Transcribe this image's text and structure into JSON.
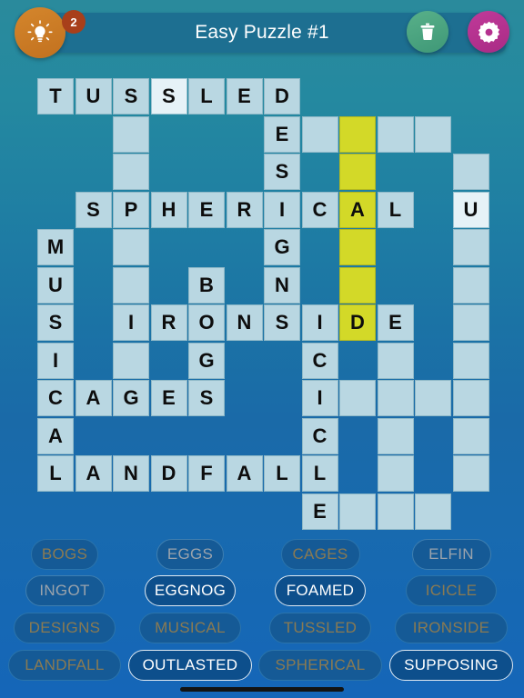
{
  "header": {
    "title": "Easy Puzzle #1",
    "hint_badge_count": "2",
    "hint_icon": "lightbulb-icon",
    "trash_icon": "trash-icon",
    "settings_icon": "gear-icon"
  },
  "colors": {
    "accent_orange": "#c2711f",
    "accent_green": "#3f9877",
    "accent_magenta": "#a92b85",
    "highlight_yellow": "#d3d928",
    "cell_open": "#b9d7e2",
    "cell_focus": "#e6f2f7",
    "header_bar": "#1d6f91"
  },
  "grid": {
    "columns": 12,
    "rows": 12,
    "cell_size": 41.5,
    "cells": [
      {
        "r": 0,
        "c": 0,
        "l": "T",
        "s": "open"
      },
      {
        "r": 0,
        "c": 1,
        "l": "U",
        "s": "open"
      },
      {
        "r": 0,
        "c": 2,
        "l": "S",
        "s": "open"
      },
      {
        "r": 0,
        "c": 3,
        "l": "S",
        "s": "focus"
      },
      {
        "r": 0,
        "c": 4,
        "l": "L",
        "s": "open"
      },
      {
        "r": 0,
        "c": 5,
        "l": "E",
        "s": "open"
      },
      {
        "r": 0,
        "c": 6,
        "l": "D",
        "s": "open"
      },
      {
        "r": 1,
        "c": 2,
        "l": "",
        "s": "open"
      },
      {
        "r": 1,
        "c": 6,
        "l": "E",
        "s": "open"
      },
      {
        "r": 1,
        "c": 7,
        "l": "",
        "s": "open"
      },
      {
        "r": 1,
        "c": 8,
        "l": "",
        "s": "hl"
      },
      {
        "r": 1,
        "c": 9,
        "l": "",
        "s": "open"
      },
      {
        "r": 1,
        "c": 10,
        "l": "",
        "s": "open"
      },
      {
        "r": 2,
        "c": 2,
        "l": "",
        "s": "open"
      },
      {
        "r": 2,
        "c": 6,
        "l": "S",
        "s": "open"
      },
      {
        "r": 2,
        "c": 8,
        "l": "",
        "s": "hl"
      },
      {
        "r": 2,
        "c": 11,
        "l": "",
        "s": "open"
      },
      {
        "r": 3,
        "c": 1,
        "l": "S",
        "s": "open"
      },
      {
        "r": 3,
        "c": 2,
        "l": "P",
        "s": "open"
      },
      {
        "r": 3,
        "c": 3,
        "l": "H",
        "s": "open"
      },
      {
        "r": 3,
        "c": 4,
        "l": "E",
        "s": "open"
      },
      {
        "r": 3,
        "c": 5,
        "l": "R",
        "s": "open"
      },
      {
        "r": 3,
        "c": 6,
        "l": "I",
        "s": "open"
      },
      {
        "r": 3,
        "c": 7,
        "l": "C",
        "s": "open"
      },
      {
        "r": 3,
        "c": 8,
        "l": "A",
        "s": "hl"
      },
      {
        "r": 3,
        "c": 9,
        "l": "L",
        "s": "open"
      },
      {
        "r": 3,
        "c": 11,
        "l": "U",
        "s": "focus"
      },
      {
        "r": 4,
        "c": 0,
        "l": "M",
        "s": "open"
      },
      {
        "r": 4,
        "c": 2,
        "l": "",
        "s": "open"
      },
      {
        "r": 4,
        "c": 6,
        "l": "G",
        "s": "open"
      },
      {
        "r": 4,
        "c": 8,
        "l": "",
        "s": "hl"
      },
      {
        "r": 4,
        "c": 11,
        "l": "",
        "s": "open"
      },
      {
        "r": 5,
        "c": 0,
        "l": "U",
        "s": "open"
      },
      {
        "r": 5,
        "c": 2,
        "l": "",
        "s": "open"
      },
      {
        "r": 5,
        "c": 4,
        "l": "B",
        "s": "open"
      },
      {
        "r": 5,
        "c": 6,
        "l": "N",
        "s": "open"
      },
      {
        "r": 5,
        "c": 8,
        "l": "",
        "s": "hl"
      },
      {
        "r": 5,
        "c": 11,
        "l": "",
        "s": "open"
      },
      {
        "r": 6,
        "c": 0,
        "l": "S",
        "s": "open"
      },
      {
        "r": 6,
        "c": 2,
        "l": "I",
        "s": "open"
      },
      {
        "r": 6,
        "c": 3,
        "l": "R",
        "s": "open"
      },
      {
        "r": 6,
        "c": 4,
        "l": "O",
        "s": "open"
      },
      {
        "r": 6,
        "c": 5,
        "l": "N",
        "s": "open"
      },
      {
        "r": 6,
        "c": 6,
        "l": "S",
        "s": "open"
      },
      {
        "r": 6,
        "c": 7,
        "l": "I",
        "s": "open"
      },
      {
        "r": 6,
        "c": 8,
        "l": "D",
        "s": "hl"
      },
      {
        "r": 6,
        "c": 9,
        "l": "E",
        "s": "open"
      },
      {
        "r": 6,
        "c": 11,
        "l": "",
        "s": "open"
      },
      {
        "r": 7,
        "c": 0,
        "l": "I",
        "s": "open"
      },
      {
        "r": 7,
        "c": 2,
        "l": "",
        "s": "open"
      },
      {
        "r": 7,
        "c": 4,
        "l": "G",
        "s": "open"
      },
      {
        "r": 7,
        "c": 7,
        "l": "C",
        "s": "open"
      },
      {
        "r": 7,
        "c": 9,
        "l": "",
        "s": "open"
      },
      {
        "r": 7,
        "c": 11,
        "l": "",
        "s": "open"
      },
      {
        "r": 8,
        "c": 0,
        "l": "C",
        "s": "open"
      },
      {
        "r": 8,
        "c": 1,
        "l": "A",
        "s": "open"
      },
      {
        "r": 8,
        "c": 2,
        "l": "G",
        "s": "open"
      },
      {
        "r": 8,
        "c": 3,
        "l": "E",
        "s": "open"
      },
      {
        "r": 8,
        "c": 4,
        "l": "S",
        "s": "open"
      },
      {
        "r": 8,
        "c": 7,
        "l": "I",
        "s": "open"
      },
      {
        "r": 8,
        "c": 8,
        "l": "",
        "s": "open"
      },
      {
        "r": 8,
        "c": 9,
        "l": "",
        "s": "open"
      },
      {
        "r": 8,
        "c": 10,
        "l": "",
        "s": "open"
      },
      {
        "r": 8,
        "c": 11,
        "l": "",
        "s": "open"
      },
      {
        "r": 9,
        "c": 0,
        "l": "A",
        "s": "open"
      },
      {
        "r": 9,
        "c": 7,
        "l": "C",
        "s": "open"
      },
      {
        "r": 9,
        "c": 9,
        "l": "",
        "s": "open"
      },
      {
        "r": 9,
        "c": 11,
        "l": "",
        "s": "open"
      },
      {
        "r": 10,
        "c": 0,
        "l": "L",
        "s": "open"
      },
      {
        "r": 10,
        "c": 1,
        "l": "A",
        "s": "open"
      },
      {
        "r": 10,
        "c": 2,
        "l": "N",
        "s": "open"
      },
      {
        "r": 10,
        "c": 3,
        "l": "D",
        "s": "open"
      },
      {
        "r": 10,
        "c": 4,
        "l": "F",
        "s": "open"
      },
      {
        "r": 10,
        "c": 5,
        "l": "A",
        "s": "open"
      },
      {
        "r": 10,
        "c": 6,
        "l": "L",
        "s": "open"
      },
      {
        "r": 10,
        "c": 7,
        "l": "L",
        "s": "open"
      },
      {
        "r": 10,
        "c": 9,
        "l": "",
        "s": "open"
      },
      {
        "r": 10,
        "c": 11,
        "l": "",
        "s": "open"
      },
      {
        "r": 11,
        "c": 7,
        "l": "E",
        "s": "open"
      },
      {
        "r": 11,
        "c": 8,
        "l": "",
        "s": "open"
      },
      {
        "r": 11,
        "c": 9,
        "l": "",
        "s": "open"
      },
      {
        "r": 11,
        "c": 10,
        "l": "",
        "s": "open"
      }
    ]
  },
  "wordbank": {
    "rows": [
      [
        {
          "label": "BOGS",
          "state": "used-tan"
        },
        {
          "label": "EGGS",
          "state": "used-gray"
        },
        {
          "label": "CAGES",
          "state": "used-tan"
        },
        {
          "label": "ELFIN",
          "state": "used-gray"
        }
      ],
      [
        {
          "label": "INGOT",
          "state": "used-gray"
        },
        {
          "label": "EGGNOG",
          "state": "avail"
        },
        {
          "label": "FOAMED",
          "state": "avail"
        },
        {
          "label": "ICICLE",
          "state": "used-tan"
        }
      ],
      [
        {
          "label": "DESIGNS",
          "state": "used-tan"
        },
        {
          "label": "MUSICAL",
          "state": "used-tan"
        },
        {
          "label": "TUSSLED",
          "state": "used-tan"
        },
        {
          "label": "IRONSIDE",
          "state": "used-tan"
        }
      ],
      [
        {
          "label": "LANDFALL",
          "state": "used-tan"
        },
        {
          "label": "OUTLASTED",
          "state": "avail"
        },
        {
          "label": "SPHERICAL",
          "state": "used-tan"
        },
        {
          "label": "SUPPOSING",
          "state": "avail"
        }
      ]
    ]
  }
}
